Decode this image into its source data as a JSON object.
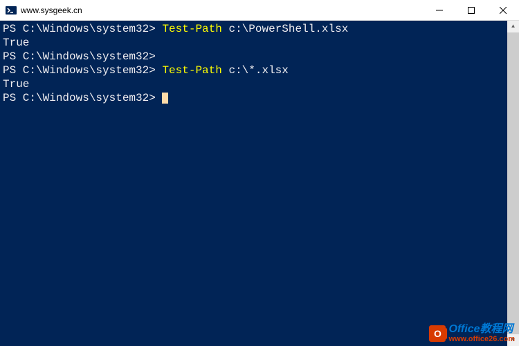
{
  "titlebar": {
    "title": "www.sysgeek.cn"
  },
  "terminal": {
    "lines": [
      {
        "prompt": "PS C:\\Windows\\system32>",
        "cmd": "Test-Path",
        "arg": "c:\\PowerShell.xlsx"
      },
      {
        "output": "True"
      },
      {
        "prompt": "PS C:\\Windows\\system32>",
        "cmd": "",
        "arg": ""
      },
      {
        "prompt": "PS C:\\Windows\\system32>",
        "cmd": "Test-Path",
        "arg": "c:\\*.xlsx"
      },
      {
        "output": "True"
      },
      {
        "prompt": "PS C:\\Windows\\system32>",
        "cmd": "",
        "arg": "",
        "cursor": true
      }
    ]
  },
  "watermark": {
    "icon_letter": "O",
    "title": "Office教程网",
    "url": "www.office26.com"
  }
}
